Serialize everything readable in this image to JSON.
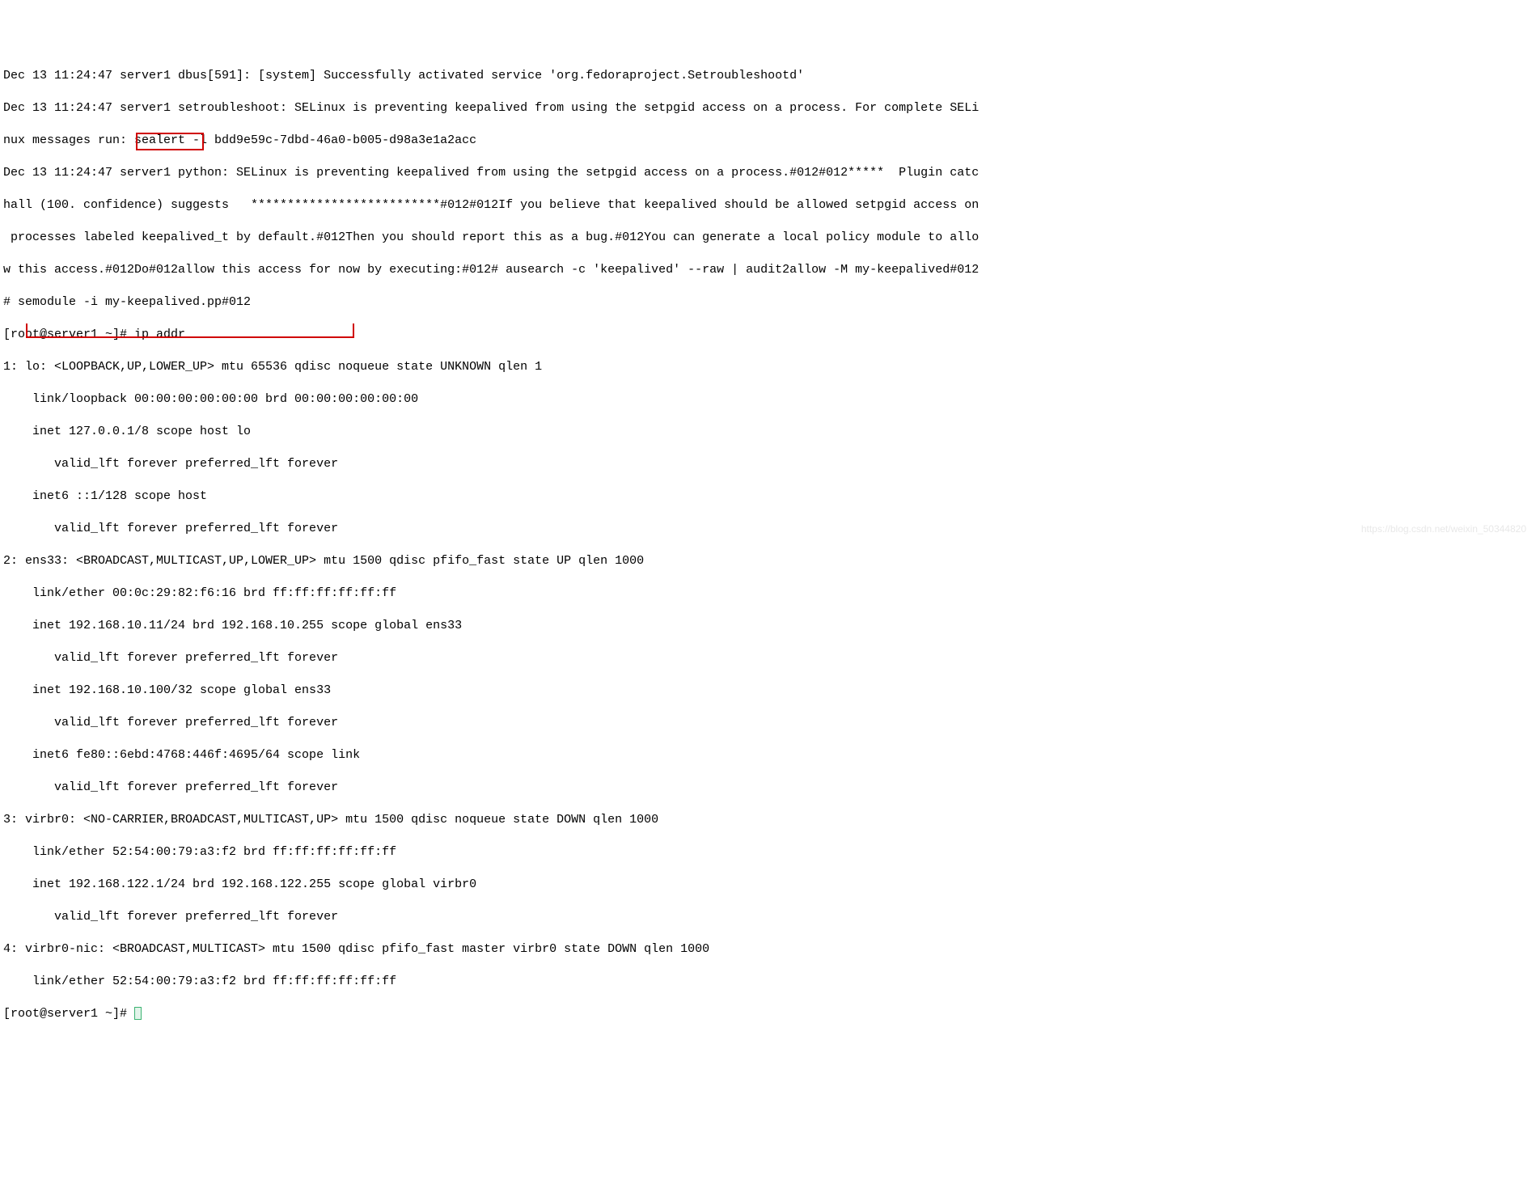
{
  "lines": {
    "l1": "Dec 13 11:24:47 server1 dbus[591]: [system] Successfully activated service 'org.fedoraproject.Setroubleshootd'",
    "l2": "Dec 13 11:24:47 server1 setroubleshoot: SELinux is preventing keepalived from using the setpgid access on a process. For complete SELi",
    "l3": "nux messages run: sealert -l bdd9e59c-7dbd-46a0-b005-d98a3e1a2acc",
    "l4": "Dec 13 11:24:47 server1 python: SELinux is preventing keepalived from using the setpgid access on a process.#012#012*****  Plugin catc",
    "l5": "hall (100. confidence) suggests   **************************#012#012If you believe that keepalived should be allowed setpgid access on",
    "l6": " processes labeled keepalived_t by default.#012Then you should report this as a bug.#012You can generate a local policy module to allo",
    "l7": "w this access.#012Do#012allow this access for now by executing:#012# ausearch -c 'keepalived' --raw | audit2allow -M my-keepalived#012",
    "l8": "# semodule -i my-keepalived.pp#012",
    "prompt1_prefix": "[root@server1 ~]# ",
    "cmd": "ip addr",
    "l10": "1: lo: <LOOPBACK,UP,LOWER_UP> mtu 65536 qdisc noqueue state UNKNOWN qlen 1",
    "l11": "    link/loopback 00:00:00:00:00:00 brd 00:00:00:00:00:00",
    "l12": "    inet 127.0.0.1/8 scope host lo",
    "l13": "       valid_lft forever preferred_lft forever",
    "l14": "    inet6 ::1/128 scope host",
    "l15": "       valid_lft forever preferred_lft forever",
    "l16": "2: ens33: <BROADCAST,MULTICAST,UP,LOWER_UP> mtu 1500 qdisc pfifo_fast state UP qlen 1000",
    "l17": "    link/ether 00:0c:29:82:f6:16 brd ff:ff:ff:ff:ff:ff",
    "l18": "    inet 192.168.10.11/24 brd 192.168.10.255 scope global ens33",
    "l19": "       valid_lft forever preferred_lft forever",
    "l20": "    inet 192.168.10.100/32 scope global ens33",
    "l21": "       valid_lft forever preferred_lft forever",
    "l22": "    inet6 fe80::6ebd:4768:446f:4695/64 scope link",
    "l23": "       valid_lft forever preferred_lft forever",
    "l24": "3: virbr0: <NO-CARRIER,BROADCAST,MULTICAST,UP> mtu 1500 qdisc noqueue state DOWN qlen 1000",
    "l25": "    link/ether 52:54:00:79:a3:f2 brd ff:ff:ff:ff:ff:ff",
    "l26": "    inet 192.168.122.1/24 brd 192.168.122.255 scope global virbr0",
    "l27": "       valid_lft forever preferred_lft forever",
    "l28": "4: virbr0-nic: <BROADCAST,MULTICAST> mtu 1500 qdisc pfifo_fast master virbr0 state DOWN qlen 1000",
    "l29": "    link/ether 52:54:00:79:a3:f2 brd ff:ff:ff:ff:ff:ff",
    "prompt2": "[root@server1 ~]# "
  },
  "watermark": "https://blog.csdn.net/weixin_50344820"
}
